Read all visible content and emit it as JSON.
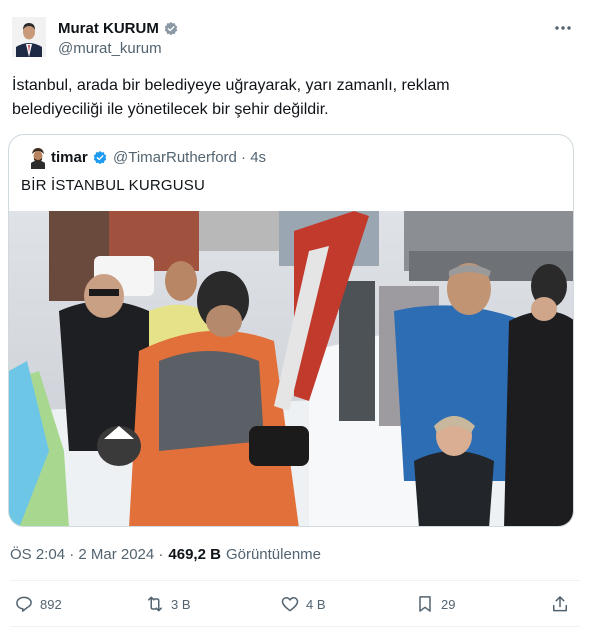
{
  "author": {
    "name": "Murat KURUM",
    "handle": "@murat_kurum"
  },
  "tweet": {
    "text_line1": "İstanbul, arada bir belediyeye uğrayarak, yarı zamanlı, reklam",
    "text_line2": "belediyeciliği ile yönetilecek bir şehir değildir."
  },
  "quote": {
    "name": "timar",
    "handle_time": "@TimarRutherford · 4s",
    "text": "BİR İSTANBUL KURGUSU"
  },
  "meta": {
    "time": "ÖS 2:04 · 2 Mar 2024 ·",
    "views_count": "469,2 B",
    "views_label": "Görüntülenme"
  },
  "actions": {
    "replies": "892",
    "reposts": "3 B",
    "likes": "4 B",
    "bookmarks": "29"
  },
  "colors": {
    "verified": "#1d9bf0",
    "text": "#0f1419",
    "secondary": "#536471",
    "border": "#cfd9de"
  }
}
